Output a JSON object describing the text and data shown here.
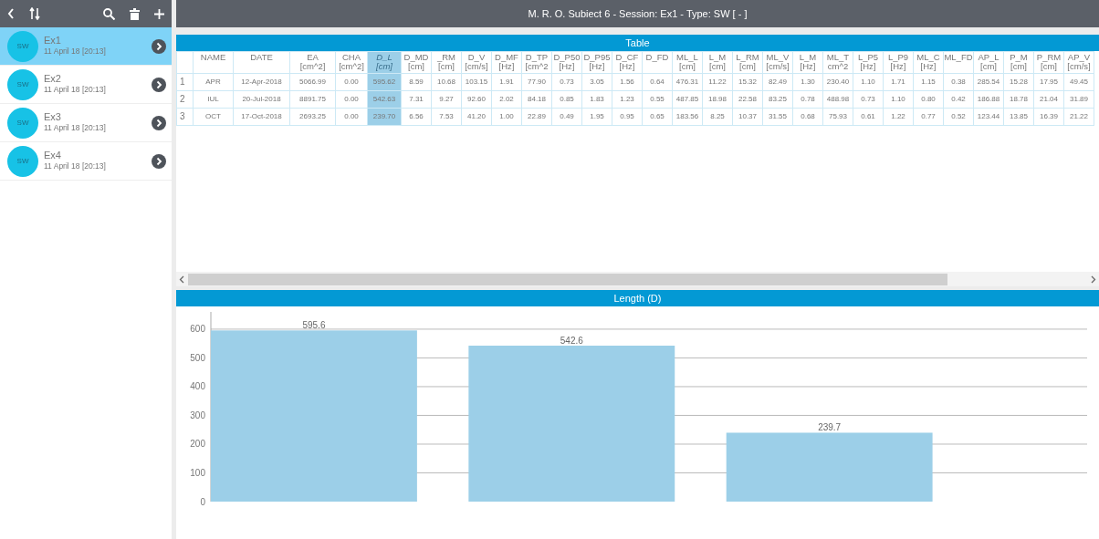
{
  "header": {
    "title": "M. R. O. Subiect 6 - Session: Ex1 - Type: SW [ - ]"
  },
  "sidebar": {
    "items": [
      {
        "avatar": "SW",
        "name": "Ex1",
        "date": "11 April 18 [20:13]",
        "selected": true
      },
      {
        "avatar": "SW",
        "name": "Ex2",
        "date": "11 April 18 [20:13]",
        "selected": false
      },
      {
        "avatar": "SW",
        "name": "Ex3",
        "date": "11 April 18 [20:13]",
        "selected": false
      },
      {
        "avatar": "SW",
        "name": "Ex4",
        "date": "11 April 18 [20:13]",
        "selected": false
      }
    ]
  },
  "table": {
    "title": "Table",
    "columns": [
      {
        "name": "NAME",
        "selected": false
      },
      {
        "name": "DATE",
        "selected": false
      },
      {
        "name": "EA",
        "unit": "[cm^2]",
        "selected": false
      },
      {
        "name": "CHA",
        "unit": "[cm^2]",
        "selected": false
      },
      {
        "name": "D_L",
        "unit": "[cm]",
        "selected": true
      },
      {
        "name": "D_MD",
        "unit": "[cm]",
        "selected": false
      },
      {
        "name": "_RM",
        "unit": "[cm]",
        "selected": false
      },
      {
        "name": "D_V",
        "unit": "[cm/s]",
        "selected": false
      },
      {
        "name": "D_MF",
        "unit": "[Hz]",
        "selected": false
      },
      {
        "name": "D_TP",
        "unit": "[cm^2",
        "selected": false
      },
      {
        "name": "D_P50",
        "unit": "[Hz]",
        "selected": false
      },
      {
        "name": "D_P95",
        "unit": "[Hz]",
        "selected": false
      },
      {
        "name": "D_CF",
        "unit": "[Hz]",
        "selected": false
      },
      {
        "name": "D_FD",
        "selected": false
      },
      {
        "name": "ML_L",
        "unit": "[cm]",
        "selected": false
      },
      {
        "name": "L_M",
        "unit": "[cm]",
        "selected": false
      },
      {
        "name": "L_RM",
        "unit": "[cm]",
        "selected": false
      },
      {
        "name": "ML_V",
        "unit": "[cm/s]",
        "selected": false
      },
      {
        "name": "L_M",
        "unit": "[Hz]",
        "selected": false
      },
      {
        "name": "ML_T",
        "unit": "cm^2",
        "selected": false
      },
      {
        "name": "L_P5",
        "unit": "[Hz]",
        "selected": false
      },
      {
        "name": "L_P9",
        "unit": "[Hz]",
        "selected": false
      },
      {
        "name": "ML_C",
        "unit": "[Hz]",
        "selected": false
      },
      {
        "name": "ML_FD",
        "selected": false
      },
      {
        "name": "AP_L",
        "unit": "[cm]",
        "selected": false
      },
      {
        "name": "P_M",
        "unit": "[cm]",
        "selected": false
      },
      {
        "name": "P_RM",
        "unit": "[cm]",
        "selected": false
      },
      {
        "name": "AP_V",
        "unit": "[cm/s]",
        "selected": false
      }
    ],
    "rows": [
      {
        "index": "1",
        "cells": [
          "APR",
          "12-Apr-2018",
          "5066.99",
          "0.00",
          "595.62",
          "8.59",
          "10.68",
          "103.15",
          "1.91",
          "77.90",
          "0.73",
          "3.05",
          "1.56",
          "0.64",
          "476.31",
          "11.22",
          "15.32",
          "82.49",
          "1.30",
          "230.40",
          "1.10",
          "1.71",
          "1.15",
          "0.38",
          "285.54",
          "15.28",
          "17.95",
          "49.45"
        ]
      },
      {
        "index": "2",
        "cells": [
          "IUL",
          "20-Jul-2018",
          "8891.75",
          "0.00",
          "542.63",
          "7.31",
          "9.27",
          "92.60",
          "2.02",
          "84.18",
          "0.85",
          "1.83",
          "1.23",
          "0.55",
          "487.85",
          "18.98",
          "22.58",
          "83.25",
          "0.78",
          "488.98",
          "0.73",
          "1.10",
          "0.80",
          "0.42",
          "186.88",
          "18.78",
          "21.04",
          "31.89"
        ]
      },
      {
        "index": "3",
        "cells": [
          "OCT",
          "17-Oct-2018",
          "2693.25",
          "0.00",
          "239.70",
          "6.56",
          "7.53",
          "41.20",
          "1.00",
          "22.89",
          "0.49",
          "1.95",
          "0.95",
          "0.65",
          "183.56",
          "8.25",
          "10.37",
          "31.55",
          "0.68",
          "75.93",
          "0.61",
          "1.22",
          "0.77",
          "0.52",
          "123.44",
          "13.85",
          "16.39",
          "21.22"
        ]
      }
    ]
  },
  "chart": {
    "title": "Length (D)",
    "chart_data": {
      "type": "bar",
      "series": [
        {
          "color": "#9ccfe8",
          "values": [
            595.6,
            542.6,
            239.7
          ]
        }
      ],
      "ylim": [
        0,
        660
      ],
      "yticks": [
        0,
        100,
        200,
        300,
        400,
        500,
        600
      ],
      "grid": true,
      "data_labels": true
    }
  }
}
